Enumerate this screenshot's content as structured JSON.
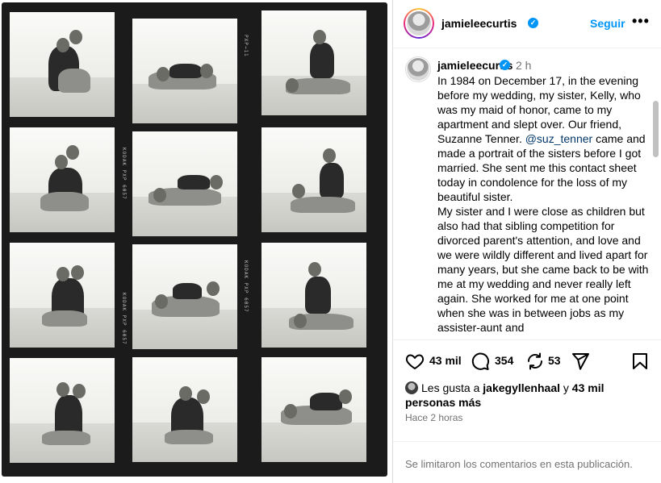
{
  "post": {
    "username": "jamieleecurtis",
    "follow_label": "Seguir",
    "more_label": "•••",
    "caption_time": "2 h",
    "caption_before_mention": "In 1984 on December 17, in the evening before my wedding, my sister, Kelly, who was my maid of honor, came to my apartment and slept over. Our friend, Suzanne Tenner. ",
    "caption_mention": "@suz_tenner",
    "caption_after_mention": "  came and made a portrait of the sisters before I got married. She sent me this contact sheet today in condolence for the loss of my beautiful sister.\nMy sister and I were close as children but also had that sibling competition for divorced parent's attention, and love and we were wildly different and lived apart for many years, but she came back to be with me at my wedding and never really left again. She worked for me at one point when she was in between jobs as my assister-aunt and",
    "likes_count": "43 mil",
    "comments_count": "354",
    "shares_count": "53",
    "likes_prefix": "Les gusta a ",
    "likes_user": "jakegyllenhaal",
    "likes_middle": " y ",
    "likes_others": "43 mil personas más",
    "timestamp": "Hace 2 horas",
    "comments_disabled": "Se limitaron los comentarios en esta publicación."
  },
  "icons": {
    "verified": "verified-badge-icon",
    "like": "heart-icon",
    "comment": "comment-bubble-icon",
    "share": "repost-icon",
    "send": "send-paper-plane-icon",
    "save": "bookmark-icon"
  },
  "colors": {
    "accent": "#0095f6",
    "muted": "#737373",
    "mention": "#00376b"
  }
}
